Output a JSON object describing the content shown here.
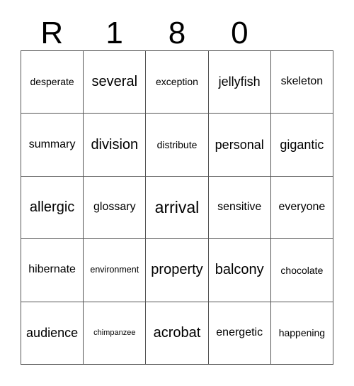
{
  "card": {
    "header_letters": [
      "R",
      "1",
      "8",
      "0",
      ""
    ],
    "columns": 5,
    "rows": 5,
    "grid_line_color": "#555555",
    "text_color": "#000000",
    "background_color": "#ffffff",
    "rows_data": [
      [
        {
          "word": "desperate",
          "size": "s-s"
        },
        {
          "word": "several",
          "size": "s-xl"
        },
        {
          "word": "exception",
          "size": "s-s"
        },
        {
          "word": "jellyfish",
          "size": "s-l"
        },
        {
          "word": "skeleton",
          "size": "s-m"
        }
      ],
      [
        {
          "word": "summary",
          "size": "s-m"
        },
        {
          "word": "division",
          "size": "s-xl"
        },
        {
          "word": "distribute",
          "size": "s-s"
        },
        {
          "word": "personal",
          "size": "s-l"
        },
        {
          "word": "gigantic",
          "size": "s-l"
        }
      ],
      [
        {
          "word": "allergic",
          "size": "s-xl"
        },
        {
          "word": "glossary",
          "size": "s-m"
        },
        {
          "word": "arrival",
          "size": "s-xxl"
        },
        {
          "word": "sensitive",
          "size": "s-m"
        },
        {
          "word": "everyone",
          "size": "s-m"
        }
      ],
      [
        {
          "word": "hibernate",
          "size": "s-m"
        },
        {
          "word": "environment",
          "size": "s-xs"
        },
        {
          "word": "property",
          "size": "s-xl"
        },
        {
          "word": "balcony",
          "size": "s-xl"
        },
        {
          "word": "chocolate",
          "size": "s-s"
        }
      ],
      [
        {
          "word": "audience",
          "size": "s-l"
        },
        {
          "word": "chimpanzee",
          "size": "s-xxs"
        },
        {
          "word": "acrobat",
          "size": "s-xl"
        },
        {
          "word": "energetic",
          "size": "s-m"
        },
        {
          "word": "happening",
          "size": "s-s"
        }
      ]
    ]
  }
}
